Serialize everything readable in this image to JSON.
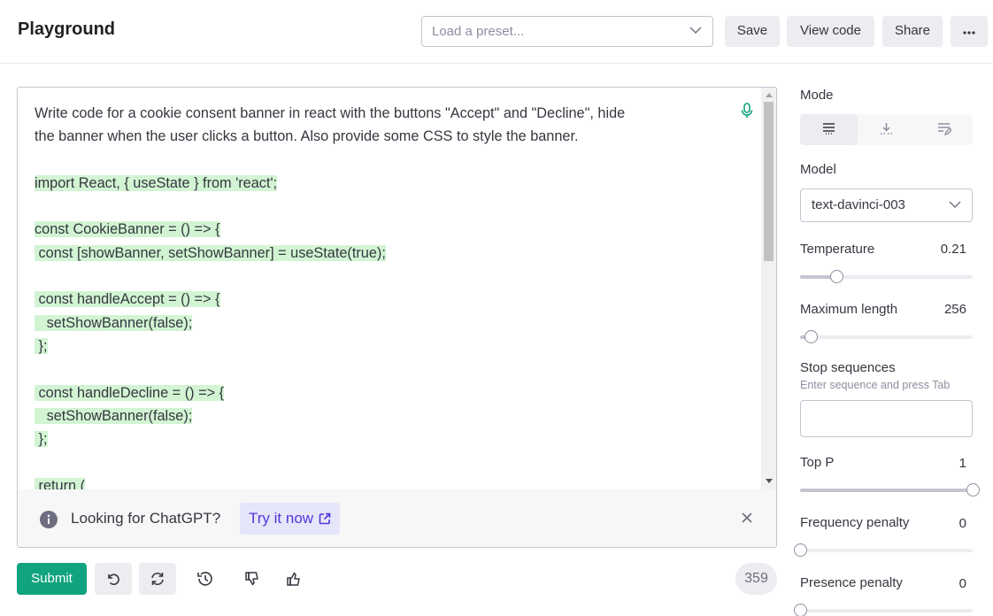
{
  "header": {
    "title": "Playground",
    "preset_placeholder": "Load a preset...",
    "save_label": "Save",
    "view_code_label": "View code",
    "share_label": "Share"
  },
  "editor": {
    "lines": [
      {
        "text": "Write code for a cookie consent banner in react with the buttons \"Accept\" and \"Decline\", hide",
        "hl": false
      },
      {
        "text": "the banner when the user clicks a button. Also provide some CSS to style the banner.",
        "hl": false
      },
      {
        "text": "",
        "hl": false
      },
      {
        "text": "import React, { useState } from 'react';",
        "hl": true
      },
      {
        "text": "",
        "hl": false
      },
      {
        "text": "const CookieBanner = () => {",
        "hl": true
      },
      {
        "text": " const [showBanner, setShowBanner] = useState(true);",
        "hl": true
      },
      {
        "text": "",
        "hl": false
      },
      {
        "text": " const handleAccept = () => {",
        "hl": true
      },
      {
        "text": "   setShowBanner(false);",
        "hl": true
      },
      {
        "text": " };",
        "hl": true
      },
      {
        "text": "",
        "hl": false
      },
      {
        "text": " const handleDecline = () => {",
        "hl": true
      },
      {
        "text": "   setShowBanner(false);",
        "hl": true
      },
      {
        "text": " };",
        "hl": true
      },
      {
        "text": "",
        "hl": false
      },
      {
        "text": " return (",
        "hl": true
      }
    ]
  },
  "banner": {
    "text": "Looking for ChatGPT?",
    "link_label": "Try it now"
  },
  "toolbar": {
    "submit_label": "Submit",
    "token_count": "359"
  },
  "settings": {
    "mode_label": "Mode",
    "mode_active": "complete",
    "model_label": "Model",
    "model_value": "text-davinci-003",
    "temperature_label": "Temperature",
    "temperature_value": "0.21",
    "temperature_fraction": 0.21,
    "max_length_label": "Maximum length",
    "max_length_value": "256",
    "max_length_fraction": 0.06,
    "stop_label": "Stop sequences",
    "stop_hint": "Enter sequence and press Tab",
    "top_p_label": "Top P",
    "top_p_value": "1",
    "top_p_fraction": 1.0,
    "freq_label": "Frequency penalty",
    "freq_value": "0",
    "freq_fraction": 0.0,
    "presence_label": "Presence penalty",
    "presence_value": "0",
    "presence_fraction": 0.0
  },
  "colors": {
    "accent": "#10a37f",
    "highlight": "#d2f4d3",
    "link": "#5436da"
  }
}
